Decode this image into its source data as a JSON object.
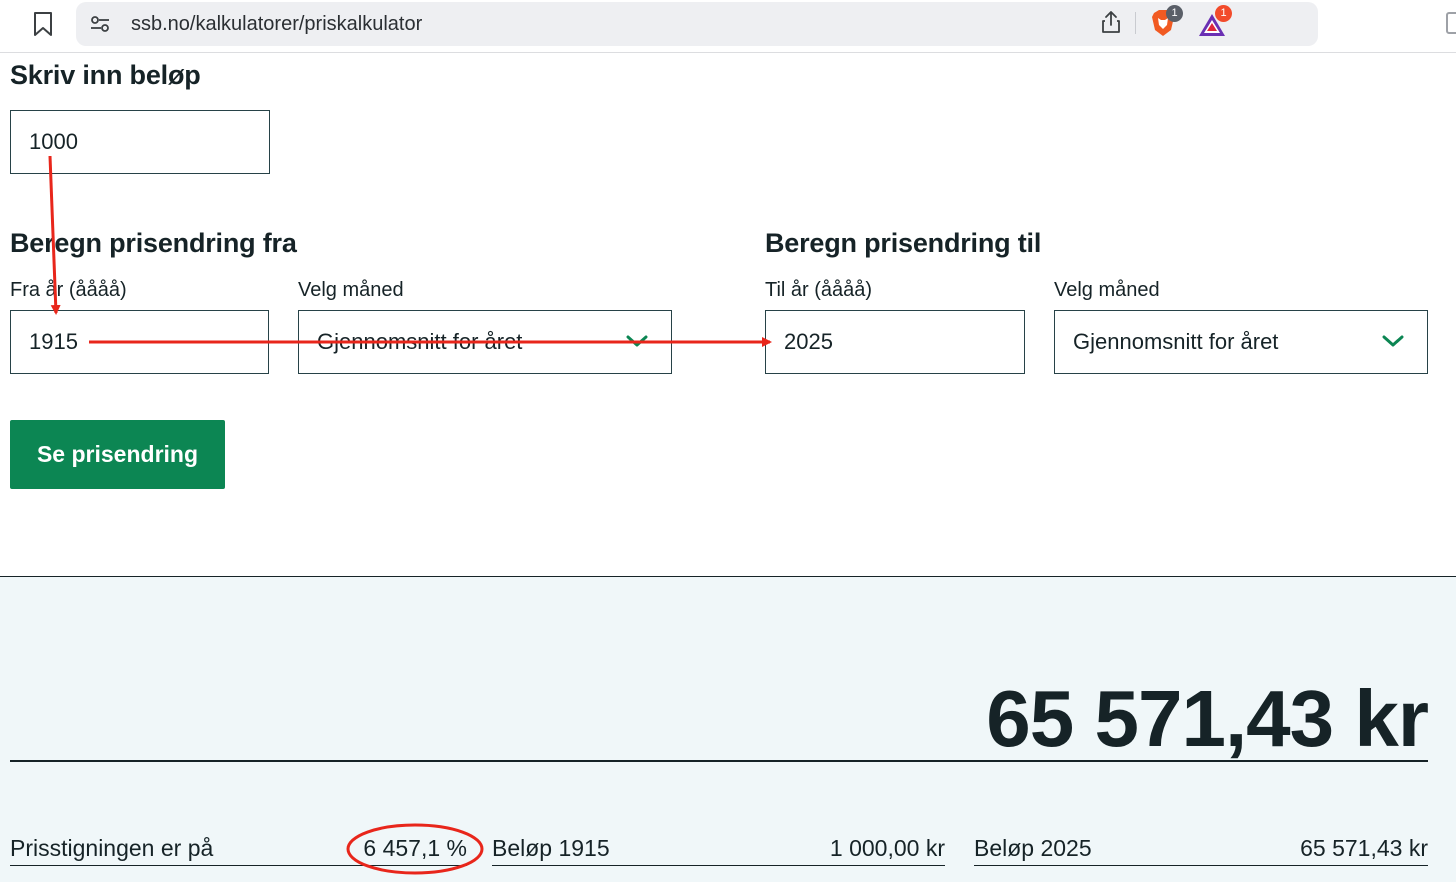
{
  "browser": {
    "url": "ssb.no/kalkulatorer/priskalkulator",
    "brave_badge": "1",
    "rewards_badge": "1"
  },
  "amount_section": {
    "heading": "Skriv inn beløp",
    "amount_value": "1000"
  },
  "from_section": {
    "heading": "Beregn prisendring fra",
    "year_label": "Fra år (åååå)",
    "year_value": "1915",
    "month_label": "Velg måned",
    "month_value": "Gjennomsnitt for året"
  },
  "to_section": {
    "heading": "Beregn prisendring til",
    "year_label": "Til år (åååå)",
    "year_value": "2025",
    "month_label": "Velg måned",
    "month_value": "Gjennomsnitt for året"
  },
  "submit_label": "Se prisendring",
  "result": {
    "total": "65 571,43 kr",
    "increase_label": "Prisstigningen er på",
    "increase_value": "6 457,1 %",
    "from_amount_label": "Beløp 1915",
    "from_amount_value": "1 000,00 kr",
    "to_amount_label": "Beløp 2025",
    "to_amount_value": "65 571,43 kr"
  },
  "colors": {
    "accent_green": "#0c8653",
    "annotation_red": "#e8261b",
    "text_dark": "#162327",
    "panel_bg": "#f0f7f9"
  }
}
